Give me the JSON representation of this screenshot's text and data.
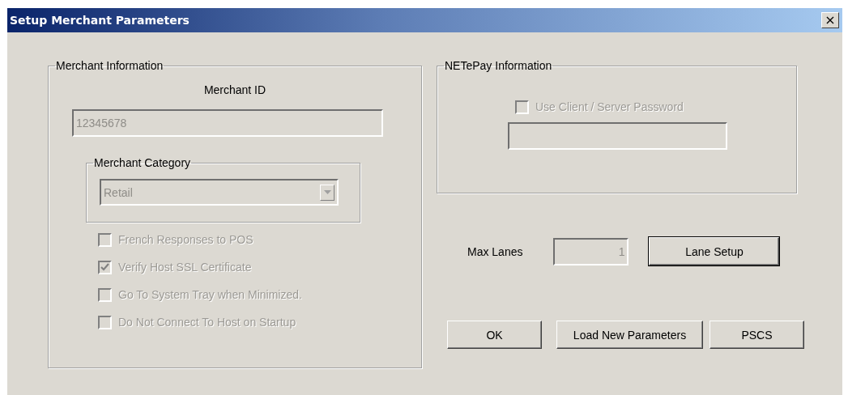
{
  "window": {
    "title": "Setup Merchant Parameters",
    "close": "×"
  },
  "merchant_information": {
    "title": "Merchant Information",
    "merchant_id_label": "Merchant ID",
    "merchant_id": {
      "value": "12345678",
      "disabled": true
    },
    "merchant_category": {
      "title": "Merchant Category",
      "value": "Retail",
      "disabled": true
    },
    "options": [
      {
        "label": "French Responses to POS",
        "checked": false,
        "disabled": true
      },
      {
        "label": "Verify Host SSL Certificate",
        "checked": true,
        "disabled": true
      },
      {
        "label": "Go To System Tray when Minimized.",
        "checked": false,
        "disabled": true
      },
      {
        "label": "Do Not Connect To Host on Startup",
        "checked": false,
        "disabled": true
      }
    ]
  },
  "netepay_information": {
    "title": "NETePay Information",
    "password_option": {
      "label": "Use Client / Server Password",
      "checked": false,
      "disabled": true
    },
    "password": {
      "disabled": true
    }
  },
  "max_lanes": {
    "label": "Max Lanes",
    "value": "1",
    "disabled": true
  },
  "lane_setup_button": {
    "label": "Lane Setup",
    "default": true
  },
  "buttons": [
    {
      "label": "OK",
      "default": false
    },
    {
      "label": "Load New Parameters",
      "default": false
    },
    {
      "label": "PSCS",
      "default": false
    }
  ]
}
